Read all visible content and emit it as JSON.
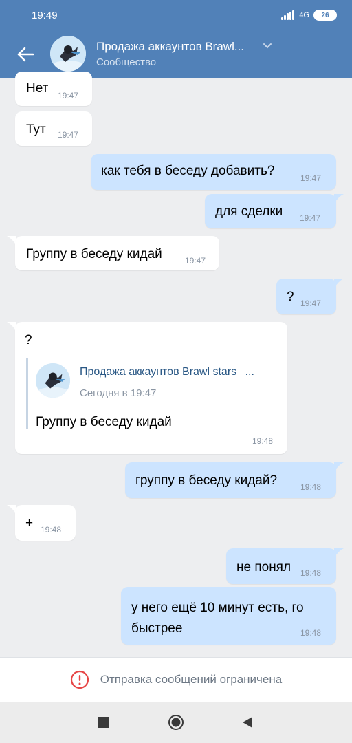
{
  "status_bar": {
    "time": "19:49",
    "network": "4G",
    "battery": "26"
  },
  "header": {
    "title": "Продажа аккаунтов Brawl...",
    "subtitle": "Сообщество"
  },
  "messages": [
    {
      "direction": "in",
      "text": "Нет",
      "time": "19:47"
    },
    {
      "direction": "in",
      "text": "Тут",
      "time": "19:47"
    },
    {
      "direction": "out",
      "text": "как тебя в беседу добавить?",
      "time": "19:47"
    },
    {
      "direction": "out",
      "text": "для сделки",
      "time": "19:47"
    },
    {
      "direction": "in",
      "text": "Группу в беседу кидай",
      "time": "19:47"
    },
    {
      "direction": "out",
      "text": "?",
      "time": "19:47"
    },
    {
      "direction": "in",
      "text": "?",
      "time": "19:48",
      "reply": {
        "author": "Продажа аккаунтов Brawl stars",
        "ellipsis": "...",
        "date": "Сегодня в 19:47",
        "text": "Группу в беседу кидай"
      }
    },
    {
      "direction": "out",
      "text": "группу в беседу кидай?",
      "time": "19:48"
    },
    {
      "direction": "in",
      "text": "+",
      "time": "19:48"
    },
    {
      "direction": "out",
      "text": "не понял",
      "time": "19:48"
    },
    {
      "direction": "out",
      "text": "у него ещё 10 минут есть, го",
      "text2": "быстрее",
      "time": "19:48"
    }
  ],
  "composer": {
    "restricted_text": "Отправка сообщений ограничена"
  },
  "colors": {
    "header": "#5181b8",
    "outgoing": "#cce4ff",
    "incoming": "#ffffff",
    "background": "#edeef0",
    "warning": "#e64646"
  },
  "icons": [
    "back-arrow-icon",
    "chevron-down-icon",
    "warning-icon",
    "stop-icon",
    "home-icon",
    "back-triangle-icon"
  ]
}
